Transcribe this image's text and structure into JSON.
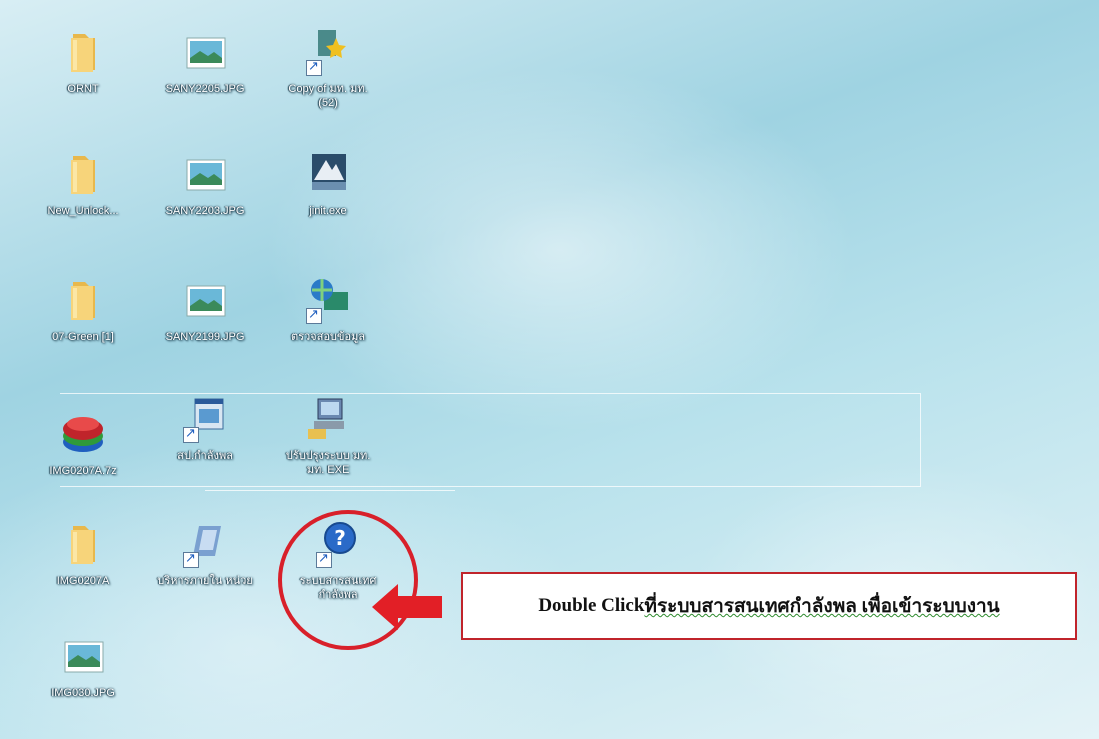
{
  "desktop": {
    "icons": [
      {
        "label": "ORNT",
        "type": "folder"
      },
      {
        "label": "SANY2205.JPG",
        "type": "image"
      },
      {
        "label": "Copy of มท. มท.(52)",
        "type": "shortcut-star"
      },
      {
        "label": "New_Unlock...",
        "type": "folder"
      },
      {
        "label": "SANY2203.JPG",
        "type": "image"
      },
      {
        "label": "jinit.exe",
        "type": "exe"
      },
      {
        "label": "07-Green [1]",
        "type": "folder"
      },
      {
        "label": "SANY2199.JPG",
        "type": "image"
      },
      {
        "label": "ตรวจสอบข้อมูล",
        "type": "network-shortcut"
      },
      {
        "label": "IMG0207A.7z",
        "type": "archive"
      },
      {
        "label": "สป.กำลังพล",
        "type": "app-shortcut"
      },
      {
        "label": "ปรับปรุงระบบ มท. มท. EXE",
        "type": "setup"
      },
      {
        "label": "IMG0207A",
        "type": "folder"
      },
      {
        "label": "บริหารภายใน หน่วย",
        "type": "app-shortcut"
      },
      {
        "label": "ระบบสารสนเทศ กำลังพล",
        "type": "help-shortcut"
      },
      {
        "label": "IMG030.JPG",
        "type": "image"
      }
    ]
  },
  "callout": {
    "prefix": "Double Click ",
    "text": "ที่ระบบสารสนเทศกำลังพล เพื่อเข้าระบบงาน"
  },
  "colors": {
    "highlight": "#d8202a",
    "callout_border": "#c0242b"
  }
}
